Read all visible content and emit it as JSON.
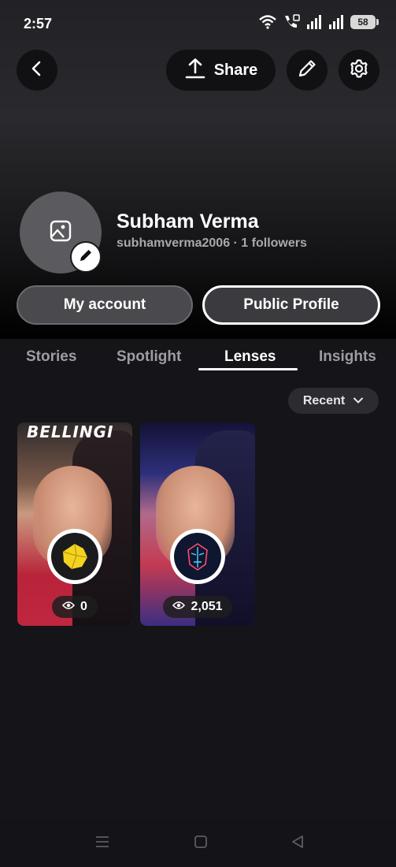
{
  "status": {
    "time": "2:57",
    "battery": "58",
    "icons": [
      "wifi-icon",
      "call-icon",
      "signal-icon",
      "signal-icon",
      "battery-icon"
    ]
  },
  "header": {
    "share_label": "Share",
    "icons": [
      "back-icon",
      "share-upload-icon",
      "pencil-icon",
      "gear-icon"
    ]
  },
  "profile": {
    "name": "Subham Verma",
    "meta": "subhamverma2006 · 1 followers"
  },
  "buttons": {
    "my_account": "My account",
    "public_profile": "Public Profile"
  },
  "tabs": [
    {
      "label": "Stories"
    },
    {
      "label": "Spotlight"
    },
    {
      "label": "Lenses",
      "active": true
    },
    {
      "label": "Insights"
    }
  ],
  "sort": {
    "label": "Recent"
  },
  "lenses": [
    {
      "banner": "BELLINGI",
      "views": "0",
      "lens_icon": "yellow-cube-lens-icon"
    },
    {
      "banner": "",
      "views": "2,051",
      "lens_icon": "cyber-mask-lens-icon"
    }
  ],
  "colors": {
    "background": "#151419",
    "active_tab": "#ffffff",
    "inactive_tab": "#9d9da2"
  }
}
